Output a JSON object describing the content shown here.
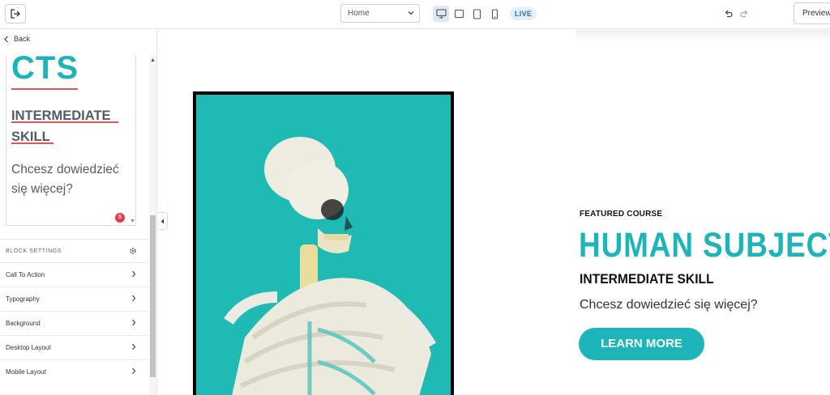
{
  "toolbar": {
    "page_select_value": "Home",
    "live_label": "LIVE",
    "preview_label": "Preview"
  },
  "sidebar": {
    "back_label": "Back",
    "editor": {
      "title_fragment": "CTS",
      "skill_line1": "INTERMEDIATE",
      "skill_line2": "SKILL",
      "cta_line1": "Chcesz dowiedzieć",
      "cta_line2": "się więcej?",
      "badge_count": "5"
    },
    "block_settings_label": "BLOCK SETTINGS",
    "menu": [
      {
        "label": "Call To Action"
      },
      {
        "label": "Typography"
      },
      {
        "label": "Background"
      },
      {
        "label": "Desktop Layout"
      },
      {
        "label": "Mobile Layout"
      }
    ]
  },
  "canvas": {
    "eyebrow": "FEATURED COURSE",
    "headline": "HUMAN SUBJECTS",
    "subhead": "INTERMEDIATE SKILL",
    "cta_text": "Chcesz dowiedzieć się więcej?",
    "button_label": "LEARN MORE"
  },
  "colors": {
    "accent": "#1db5b9",
    "photo_bg": "#1fbab3",
    "badge": "#e33b4a",
    "live_bg": "#e3eefb"
  }
}
